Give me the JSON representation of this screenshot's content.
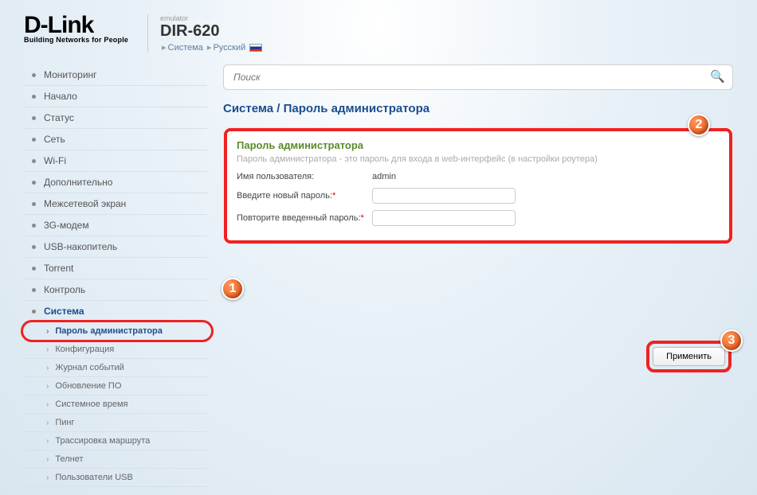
{
  "header": {
    "logo_main": "D-Link",
    "logo_sub": "Building Networks for People",
    "emulator": "emulator",
    "model": "DIR-620",
    "crumb1": "Система",
    "crumb2": "Русский"
  },
  "search": {
    "placeholder": "Поиск"
  },
  "sidebar": {
    "items": [
      {
        "label": "Мониторинг"
      },
      {
        "label": "Начало"
      },
      {
        "label": "Статус"
      },
      {
        "label": "Сеть"
      },
      {
        "label": "Wi-Fi"
      },
      {
        "label": "Дополнительно"
      },
      {
        "label": "Межсетевой экран"
      },
      {
        "label": "3G-модем"
      },
      {
        "label": "USB-накопитель"
      },
      {
        "label": "Torrent"
      },
      {
        "label": "Контроль"
      },
      {
        "label": "Система"
      }
    ],
    "sub": [
      {
        "label": "Пароль администратора"
      },
      {
        "label": "Конфигурация"
      },
      {
        "label": "Журнал событий"
      },
      {
        "label": "Обновление ПО"
      },
      {
        "label": "Системное время"
      },
      {
        "label": "Пинг"
      },
      {
        "label": "Трассировка маршрута"
      },
      {
        "label": "Телнет"
      },
      {
        "label": "Пользователи USB"
      }
    ]
  },
  "main": {
    "breadcrumb": "Система /  Пароль администратора",
    "panel_title": "Пароль администратора",
    "panel_desc": "Пароль администратора - это пароль для входа в web-интерфейс (в настройки роутера)",
    "username_label": "Имя пользователя:",
    "username_value": "admin",
    "newpass_label": "Введите новый пароль:",
    "confirm_label": "Повторите введенный пароль:",
    "apply": "Применить"
  },
  "badges": {
    "b1": "1",
    "b2": "2",
    "b3": "3"
  }
}
